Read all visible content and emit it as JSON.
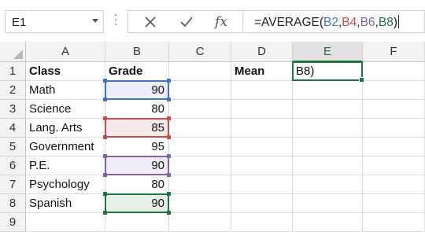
{
  "formula_bar": {
    "name_box": "E1",
    "function_label": "fx",
    "formula_prefix": "=AVERAGE(",
    "refs": [
      {
        "text": "B2",
        "color": "#4472c4"
      },
      {
        "text": ",",
        "color": "#222222"
      },
      {
        "text": "B4",
        "color": "#c0504d"
      },
      {
        "text": ",",
        "color": "#222222"
      },
      {
        "text": "B6",
        "color": "#8064a2"
      },
      {
        "text": ",",
        "color": "#222222"
      },
      {
        "text": "B8",
        "color": "#217346"
      },
      {
        "text": ")",
        "color": "#222222"
      }
    ]
  },
  "columns": [
    "A",
    "B",
    "C",
    "D",
    "E",
    "F"
  ],
  "rows": [
    "1",
    "2",
    "3",
    "4",
    "5",
    "6",
    "7",
    "8",
    "9"
  ],
  "selected_column": "E",
  "cells": {
    "A1": "Class",
    "B1": "Grade",
    "D1": "Mean",
    "E1": "B8)",
    "A2": "Math",
    "B2": "90",
    "A3": "Science",
    "B3": "80",
    "A4": "Lang. Arts",
    "B4": "85",
    "A5": "Government",
    "B5": "95",
    "A6": "P.E.",
    "B6": "90",
    "A7": "Psychology",
    "B7": "80",
    "A8": "Spanish",
    "B8": "90"
  },
  "highlight_colors": {
    "B2": {
      "border": "#4472c4",
      "fill": "#e9eef8"
    },
    "B4": {
      "border": "#c0504d",
      "fill": "#f8e9e9"
    },
    "B6": {
      "border": "#8064a2",
      "fill": "#f1edf6"
    },
    "B8": {
      "border": "#217346",
      "fill": "#e6f0e9"
    },
    "active": "#217346"
  }
}
